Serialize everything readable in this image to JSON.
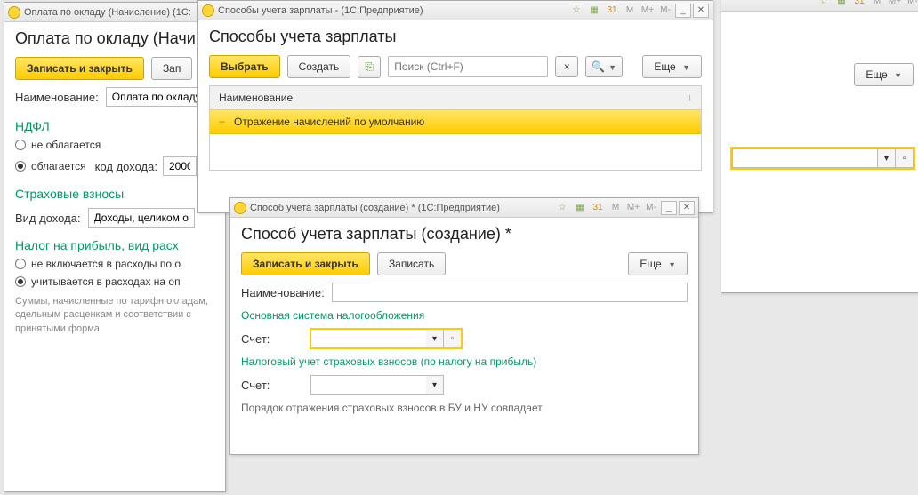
{
  "win_back": {
    "more_label": "Еще"
  },
  "win1": {
    "title": "Оплата по окладу (Начисление) (1С:",
    "heading": "Оплата по окладу (Начи",
    "save_close": "Записать и закрыть",
    "save": "Зап",
    "name_label": "Наименование:",
    "name_value": "Оплата по окладу",
    "ndfl_header": "НДФЛ",
    "ndfl_no": "не облагается",
    "ndfl_yes": "облагается",
    "kod_label": "код дохода:",
    "kod_value": "2000",
    "sv_header": "Страховые взносы",
    "vid_label": "Вид дохода:",
    "vid_value": "Доходы, целиком об",
    "np_header": "Налог на прибыль, вид расх",
    "np_no": "не включается в расходы по о",
    "np_yes": "учитывается в расходах на оп",
    "help": "Суммы, начисленные по тарифн окладам, сдельным расценкам и соответствии с принятыми форма"
  },
  "win2": {
    "title": "Способы учета зарплаты - (1С:Предприятие)",
    "heading": "Способы учета зарплаты",
    "select": "Выбрать",
    "create": "Создать",
    "search_ph": "Поиск (Ctrl+F)",
    "more": "Еще",
    "col_name": "Наименование",
    "row1": "Отражение начислений по умолчанию"
  },
  "win3": {
    "title": "Способ учета зарплаты (создание) * (1С:Предприятие)",
    "heading": "Способ учета зарплаты (создание) *",
    "save_close": "Записать и закрыть",
    "save": "Записать",
    "more": "Еще",
    "name_label": "Наименование:",
    "section1": "Основная система налогообложения",
    "account_label": "Счет:",
    "section2": "Налоговый учет страховых взносов (по налогу на прибыль)",
    "account2_label": "Счет:",
    "footer_note": "Порядок отражения страховых взносов в БУ и НУ совпадает"
  },
  "tb_icons": {
    "star": "☆",
    "calc": "▦",
    "cal": "31",
    "m": "M",
    "mp": "M+",
    "mm": "M-"
  }
}
